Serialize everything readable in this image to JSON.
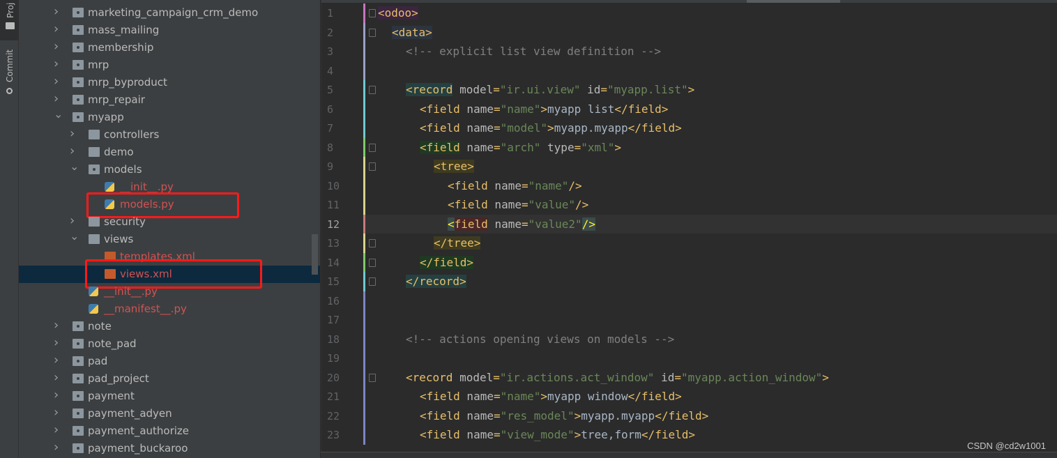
{
  "sidebar_strip": {
    "project_label": "Proj",
    "commit_label": "Commit"
  },
  "tree": {
    "items": [
      {
        "label": "marketing_campaign_crm_demo",
        "level": 0,
        "kind": "module",
        "expanded": false
      },
      {
        "label": "mass_mailing",
        "level": 0,
        "kind": "module",
        "expanded": false
      },
      {
        "label": "membership",
        "level": 0,
        "kind": "module",
        "expanded": false
      },
      {
        "label": "mrp",
        "level": 0,
        "kind": "module",
        "expanded": false
      },
      {
        "label": "mrp_byproduct",
        "level": 0,
        "kind": "module",
        "expanded": false
      },
      {
        "label": "mrp_repair",
        "level": 0,
        "kind": "module",
        "expanded": false
      },
      {
        "label": "myapp",
        "level": 0,
        "kind": "module",
        "expanded": true
      },
      {
        "label": "controllers",
        "level": 1,
        "kind": "folder",
        "expanded": false
      },
      {
        "label": "demo",
        "level": 1,
        "kind": "folder",
        "expanded": false
      },
      {
        "label": "models",
        "level": 1,
        "kind": "module",
        "expanded": true
      },
      {
        "label": "__init__.py",
        "level": 2,
        "kind": "py",
        "modified": true
      },
      {
        "label": "models.py",
        "level": 2,
        "kind": "py",
        "modified": true,
        "highlighted": true
      },
      {
        "label": "security",
        "level": 1,
        "kind": "folder",
        "expanded": false
      },
      {
        "label": "views",
        "level": 1,
        "kind": "folder",
        "expanded": true
      },
      {
        "label": "templates.xml",
        "level": 2,
        "kind": "xml",
        "modified": true
      },
      {
        "label": "views.xml",
        "level": 2,
        "kind": "xml",
        "modified": true,
        "selected": true,
        "highlighted": true
      },
      {
        "label": "__init__.py",
        "level": 1,
        "kind": "py",
        "modified": true
      },
      {
        "label": "__manifest__.py",
        "level": 1,
        "kind": "py",
        "modified": true
      },
      {
        "label": "note",
        "level": 0,
        "kind": "module",
        "expanded": false
      },
      {
        "label": "note_pad",
        "level": 0,
        "kind": "module",
        "expanded": false
      },
      {
        "label": "pad",
        "level": 0,
        "kind": "module",
        "expanded": false
      },
      {
        "label": "pad_project",
        "level": 0,
        "kind": "module",
        "expanded": false
      },
      {
        "label": "payment",
        "level": 0,
        "kind": "module",
        "expanded": false
      },
      {
        "label": "payment_adyen",
        "level": 0,
        "kind": "module",
        "expanded": false
      },
      {
        "label": "payment_authorize",
        "level": 0,
        "kind": "module",
        "expanded": false
      },
      {
        "label": "payment_buckaroo",
        "level": 0,
        "kind": "module",
        "expanded": false
      }
    ]
  },
  "editor": {
    "current_line": 12,
    "colors": {
      "tag": "#e8bf6a",
      "attr": "#bababa",
      "string": "#6a8759",
      "text": "#a9b7c6",
      "comment": "#808080"
    },
    "lines": [
      {
        "n": "1",
        "indent": 0,
        "tokens": [
          {
            "k": "tag",
            "t": "<odoo>",
            "bg": "#3b2540"
          }
        ]
      },
      {
        "n": "2",
        "indent": 1,
        "tokens": [
          {
            "k": "tag",
            "t": "<data>",
            "bg": "#2c3440"
          }
        ]
      },
      {
        "n": "3",
        "indent": 2,
        "tokens": [
          {
            "k": "com",
            "t": "<!-- explicit list view definition -->"
          }
        ]
      },
      {
        "n": "4",
        "indent": 0,
        "tokens": []
      },
      {
        "n": "5",
        "indent": 2,
        "tokens": [
          {
            "k": "tag",
            "t": "<record",
            "bg": "#254040"
          },
          {
            "k": "attr",
            "t": " model"
          },
          {
            "k": "tag",
            "t": "="
          },
          {
            "k": "str",
            "t": "\"ir.ui.view\""
          },
          {
            "k": "attr",
            "t": " id"
          },
          {
            "k": "tag",
            "t": "="
          },
          {
            "k": "str",
            "t": "\"myapp.list\""
          },
          {
            "k": "tag",
            "t": ">"
          }
        ]
      },
      {
        "n": "6",
        "indent": 3,
        "tokens": [
          {
            "k": "tag",
            "t": "<field"
          },
          {
            "k": "attr",
            "t": " name"
          },
          {
            "k": "tag",
            "t": "="
          },
          {
            "k": "str",
            "t": "\"name\""
          },
          {
            "k": "tag",
            "t": ">"
          },
          {
            "k": "text",
            "t": "myapp list"
          },
          {
            "k": "tag",
            "t": "</field>"
          }
        ]
      },
      {
        "n": "7",
        "indent": 3,
        "tokens": [
          {
            "k": "tag",
            "t": "<field"
          },
          {
            "k": "attr",
            "t": " name"
          },
          {
            "k": "tag",
            "t": "="
          },
          {
            "k": "str",
            "t": "\"model\""
          },
          {
            "k": "tag",
            "t": ">"
          },
          {
            "k": "text",
            "t": "myapp.myapp"
          },
          {
            "k": "tag",
            "t": "</field>"
          }
        ]
      },
      {
        "n": "8",
        "indent": 3,
        "tokens": [
          {
            "k": "tag",
            "t": "<field",
            "bg": "#1f3a22"
          },
          {
            "k": "attr",
            "t": " name"
          },
          {
            "k": "tag",
            "t": "="
          },
          {
            "k": "str",
            "t": "\"arch\""
          },
          {
            "k": "attr",
            "t": " type"
          },
          {
            "k": "tag",
            "t": "="
          },
          {
            "k": "str",
            "t": "\"xml\""
          },
          {
            "k": "tag",
            "t": ">"
          }
        ]
      },
      {
        "n": "9",
        "indent": 4,
        "tokens": [
          {
            "k": "tag",
            "t": "<tree>",
            "bg": "#3f3b20"
          }
        ]
      },
      {
        "n": "10",
        "indent": 5,
        "tokens": [
          {
            "k": "tag",
            "t": "<field"
          },
          {
            "k": "attr",
            "t": " name"
          },
          {
            "k": "tag",
            "t": "="
          },
          {
            "k": "str",
            "t": "\"name\""
          },
          {
            "k": "tag",
            "t": "/>"
          }
        ]
      },
      {
        "n": "11",
        "indent": 5,
        "tokens": [
          {
            "k": "tag",
            "t": "<field"
          },
          {
            "k": "attr",
            "t": " name"
          },
          {
            "k": "tag",
            "t": "="
          },
          {
            "k": "str",
            "t": "\"value\""
          },
          {
            "k": "tag",
            "t": "/>"
          }
        ]
      },
      {
        "n": "12",
        "indent": 5,
        "tokens": [
          {
            "k": "tag",
            "t": "<",
            "bg": "#3b4b4b"
          },
          {
            "k": "tag",
            "t": "field",
            "bg": "#4a2626"
          },
          {
            "k": "attr",
            "t": " name"
          },
          {
            "k": "tag",
            "t": "="
          },
          {
            "k": "str",
            "t": "\"value2\""
          },
          {
            "k": "tag",
            "t": "/>",
            "bg": "#3b4b4b"
          }
        ]
      },
      {
        "n": "13",
        "indent": 4,
        "tokens": [
          {
            "k": "tag",
            "t": "</tree>",
            "bg": "#3f3b20"
          }
        ]
      },
      {
        "n": "14",
        "indent": 3,
        "tokens": [
          {
            "k": "tag",
            "t": "</field>",
            "bg": "#1f3a22"
          }
        ]
      },
      {
        "n": "15",
        "indent": 2,
        "tokens": [
          {
            "k": "tag",
            "t": "</record>",
            "bg": "#254040"
          }
        ]
      },
      {
        "n": "16",
        "indent": 0,
        "tokens": []
      },
      {
        "n": "17",
        "indent": 0,
        "tokens": []
      },
      {
        "n": "18",
        "indent": 2,
        "tokens": [
          {
            "k": "com",
            "t": "<!-- actions opening views on models -->"
          }
        ]
      },
      {
        "n": "19",
        "indent": 0,
        "tokens": []
      },
      {
        "n": "20",
        "indent": 2,
        "tokens": [
          {
            "k": "tag",
            "t": "<record"
          },
          {
            "k": "attr",
            "t": " model"
          },
          {
            "k": "tag",
            "t": "="
          },
          {
            "k": "str",
            "t": "\"ir.actions.act_window\""
          },
          {
            "k": "attr",
            "t": " id"
          },
          {
            "k": "tag",
            "t": "="
          },
          {
            "k": "str",
            "t": "\"myapp.action_window\""
          },
          {
            "k": "tag",
            "t": ">"
          }
        ]
      },
      {
        "n": "21",
        "indent": 3,
        "tokens": [
          {
            "k": "tag",
            "t": "<field"
          },
          {
            "k": "attr",
            "t": " name"
          },
          {
            "k": "tag",
            "t": "="
          },
          {
            "k": "str",
            "t": "\"name\""
          },
          {
            "k": "tag",
            "t": ">"
          },
          {
            "k": "text",
            "t": "myapp window"
          },
          {
            "k": "tag",
            "t": "</field>"
          }
        ]
      },
      {
        "n": "22",
        "indent": 3,
        "tokens": [
          {
            "k": "tag",
            "t": "<field"
          },
          {
            "k": "attr",
            "t": " name"
          },
          {
            "k": "tag",
            "t": "="
          },
          {
            "k": "str",
            "t": "\"res_model\""
          },
          {
            "k": "tag",
            "t": ">"
          },
          {
            "k": "text",
            "t": "myapp.myapp"
          },
          {
            "k": "tag",
            "t": "</field>"
          }
        ]
      },
      {
        "n": "23",
        "indent": 3,
        "tokens": [
          {
            "k": "tag",
            "t": "<field"
          },
          {
            "k": "attr",
            "t": " name"
          },
          {
            "k": "tag",
            "t": "="
          },
          {
            "k": "str",
            "t": "\"view_mode\""
          },
          {
            "k": "tag",
            "t": ">"
          },
          {
            "k": "text",
            "t": "tree,form"
          },
          {
            "k": "tag",
            "t": "</field>"
          }
        ]
      }
    ]
  },
  "watermark": "CSDN @cd2w1001"
}
